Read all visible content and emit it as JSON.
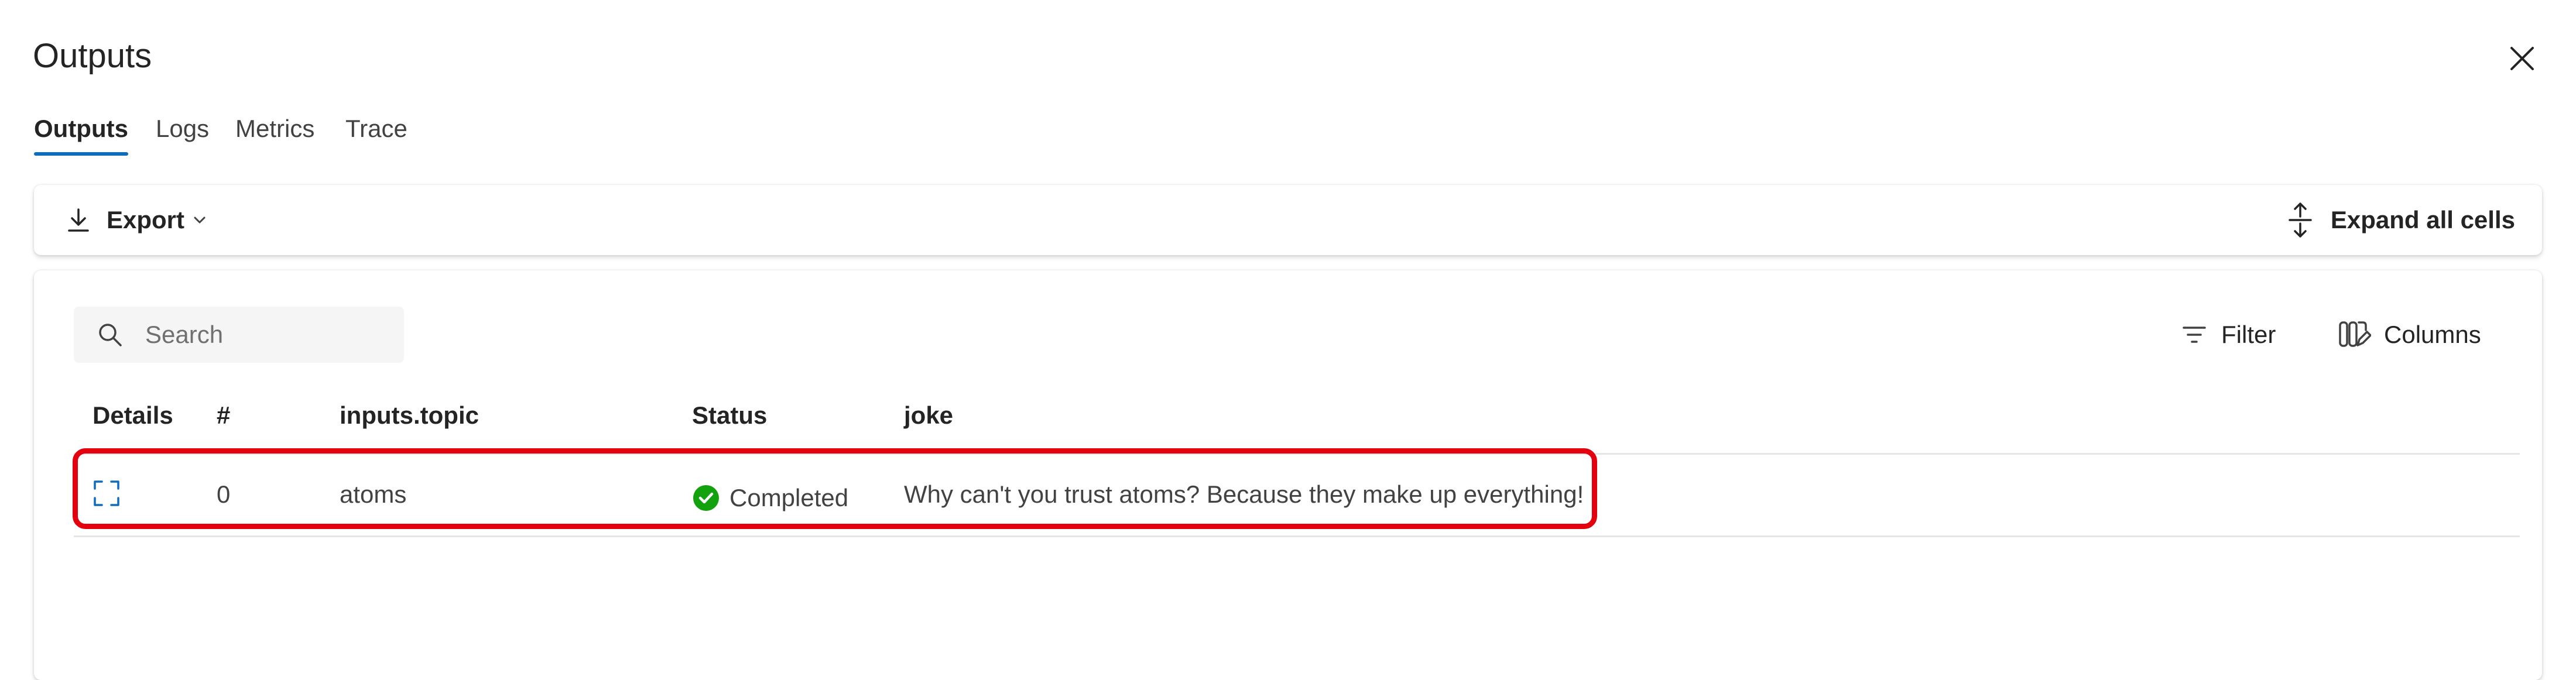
{
  "header": {
    "title": "Outputs"
  },
  "tabs": [
    {
      "label": "Outputs"
    },
    {
      "label": "Logs"
    },
    {
      "label": "Metrics"
    },
    {
      "label": "Trace"
    }
  ],
  "toolbar": {
    "export_label": "Export",
    "expand_label": "Expand all cells"
  },
  "grid": {
    "search_placeholder": "Search",
    "filter_label": "Filter",
    "columns_label": "Columns",
    "headers": {
      "details": "Details",
      "index": "#",
      "topic": "inputs.topic",
      "status": "Status",
      "joke": "joke"
    },
    "rows": [
      {
        "index": "0",
        "topic": "atoms",
        "status": "Completed",
        "joke": "Why can't you trust atoms? Because they make up everything!"
      }
    ]
  },
  "colors": {
    "accent": "#0f6cbd",
    "success": "#13a10e",
    "highlight": "#e3000f"
  },
  "icons": {
    "close": "close-icon",
    "export": "download-icon",
    "chevron": "chevron-down-icon",
    "expand": "expand-vertical-icon",
    "search": "search-icon",
    "filter": "filter-icon",
    "columns": "columns-edit-icon",
    "details": "expand-frame-icon",
    "status": "checkmark-circle-icon"
  }
}
